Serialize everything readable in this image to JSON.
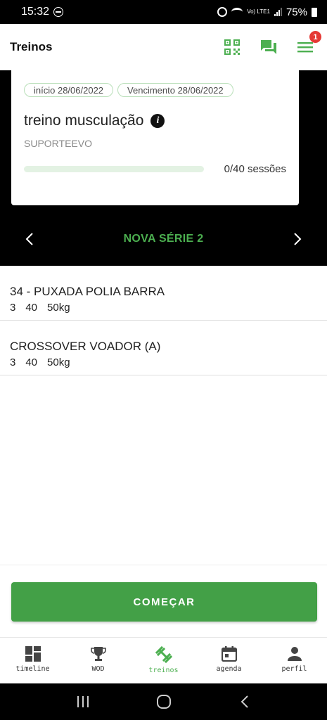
{
  "status_bar": {
    "time": "15:32",
    "volte_label": "Vo) LTE1",
    "battery": "75%"
  },
  "header": {
    "title": "Treinos",
    "notification_count": "1",
    "accent_color": "#4caf50"
  },
  "plan": {
    "start_tag": "início 28/06/2022",
    "due_tag": "Vencimento 28/06/2022",
    "title": "treino musculação",
    "subtitle": "SUPORTEEVO",
    "progress_fraction": 0,
    "progress_text": "0/40 sessões"
  },
  "series": {
    "title": "NOVA SÉRIE 2"
  },
  "exercises": [
    {
      "name": "34 - PUXADA POLIA BARRA",
      "sets": "3",
      "reps": "40",
      "load": "50kg"
    },
    {
      "name": "CROSSOVER VOADOR (A)",
      "sets": "3",
      "reps": "40",
      "load": "50kg"
    }
  ],
  "start_button": {
    "label": "COMEÇAR",
    "color": "#43a047"
  },
  "bottom_nav": [
    {
      "label": "timeline",
      "icon": "dashboard-icon",
      "active": false
    },
    {
      "label": "WOD",
      "icon": "trophy-icon",
      "active": false
    },
    {
      "label": "treinos",
      "icon": "dumbbell-icon",
      "active": true
    },
    {
      "label": "agenda",
      "icon": "calendar-icon",
      "active": false
    },
    {
      "label": "perfil",
      "icon": "person-icon",
      "active": false
    }
  ]
}
